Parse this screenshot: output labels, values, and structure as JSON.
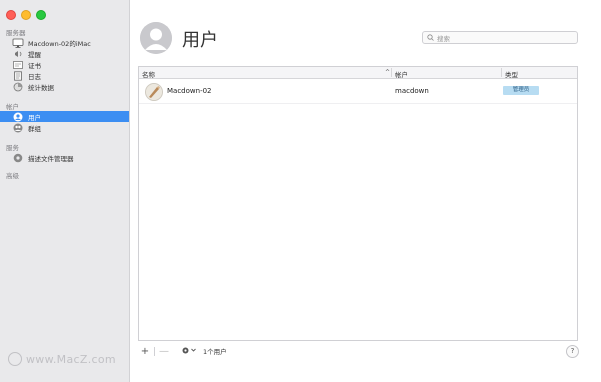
{
  "sidebar": {
    "sections": {
      "server": "服务器",
      "accounts": "帐户",
      "services": "服务",
      "advanced": "高级"
    },
    "server_items": [
      {
        "label": "Macdown-02的iMac",
        "icon": "imac-icon"
      },
      {
        "label": "提醒",
        "icon": "alerts-icon"
      },
      {
        "label": "证书",
        "icon": "certificate-icon"
      },
      {
        "label": "日志",
        "icon": "logs-icon"
      },
      {
        "label": "统计数据",
        "icon": "stats-icon"
      }
    ],
    "account_items": [
      {
        "label": "用户",
        "icon": "user-icon",
        "selected": true
      },
      {
        "label": "群组",
        "icon": "group-icon",
        "selected": false
      }
    ],
    "service_items": [
      {
        "label": "描述文件管理器",
        "icon": "profile-manager-icon"
      }
    ]
  },
  "watermark": "www.MacZ.com",
  "header": {
    "title": "用户",
    "search_placeholder": "搜索"
  },
  "table": {
    "columns": {
      "name": "名称",
      "account": "帐户",
      "type": "类型"
    },
    "rows": [
      {
        "name": "Macdown-02",
        "account": "macdown",
        "type": "管理员"
      }
    ]
  },
  "footer": {
    "add": "+",
    "remove": "—",
    "count": "1个用户",
    "help": "?"
  },
  "colors": {
    "selection": "#3c8ef2",
    "badge": "#b7dcf2"
  }
}
